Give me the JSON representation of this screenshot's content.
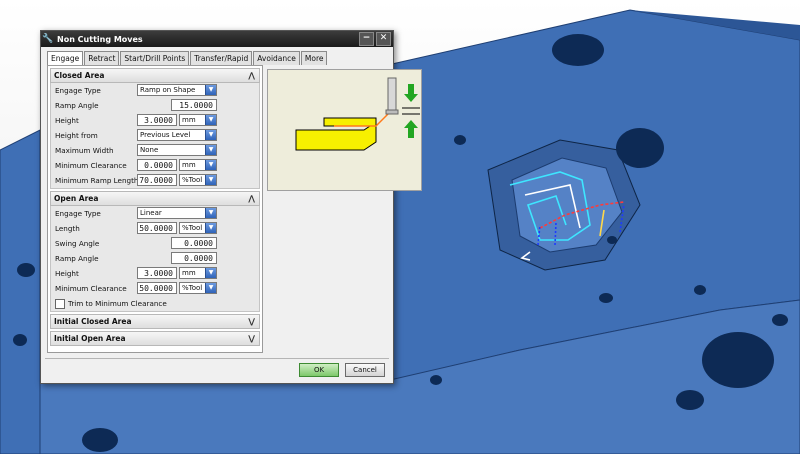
{
  "dialog": {
    "title": "Non Cutting Moves",
    "tabs": [
      {
        "label": "Engage",
        "active": true
      },
      {
        "label": "Retract",
        "active": false
      },
      {
        "label": "Start/Drill Points",
        "active": false
      },
      {
        "label": "Transfer/Rapid",
        "active": false
      },
      {
        "label": "Avoidance",
        "active": false
      },
      {
        "label": "More",
        "active": false
      }
    ],
    "closed_area": {
      "header": "Closed Area",
      "engage_type_label": "Engage Type",
      "engage_type_value": "Ramp on Shape",
      "ramp_angle_label": "Ramp Angle",
      "ramp_angle_value": "15.0000",
      "height_label": "Height",
      "height_value": "3.0000",
      "height_unit": "mm",
      "height_from_label": "Height from",
      "height_from_value": "Previous Level",
      "max_width_label": "Maximum Width",
      "max_width_value": "None",
      "min_clearance_label": "Minimum Clearance",
      "min_clearance_value": "0.0000",
      "min_clearance_unit": "mm",
      "min_ramp_length_label": "Minimum Ramp Length",
      "min_ramp_length_value": "70.0000",
      "min_ramp_length_unit": "%Tool"
    },
    "open_area": {
      "header": "Open Area",
      "engage_type_label": "Engage Type",
      "engage_type_value": "Linear",
      "length_label": "Length",
      "length_value": "50.0000",
      "length_unit": "%Tool",
      "swing_angle_label": "Swing Angle",
      "swing_angle_value": "0.0000",
      "ramp_angle_label": "Ramp Angle",
      "ramp_angle_value": "0.0000",
      "height_label": "Height",
      "height_value": "3.0000",
      "height_unit": "mm",
      "min_clearance_label": "Minimum Clearance",
      "min_clearance_value": "50.0000",
      "min_clearance_unit": "%Tool",
      "trim_label": "Trim to Minimum Clearance"
    },
    "initial_closed_area": {
      "header": "Initial Closed Area"
    },
    "initial_open_area": {
      "header": "Initial Open Area"
    },
    "ok_label": "OK",
    "cancel_label": "Cancel"
  },
  "colors": {
    "model_blue": "#3f6fb5",
    "model_dark": "#1f3f73",
    "ok_green": "#7dc86a",
    "preview_bg": "#eeeddb",
    "toolpath_cyan": "#3ee6ff"
  }
}
